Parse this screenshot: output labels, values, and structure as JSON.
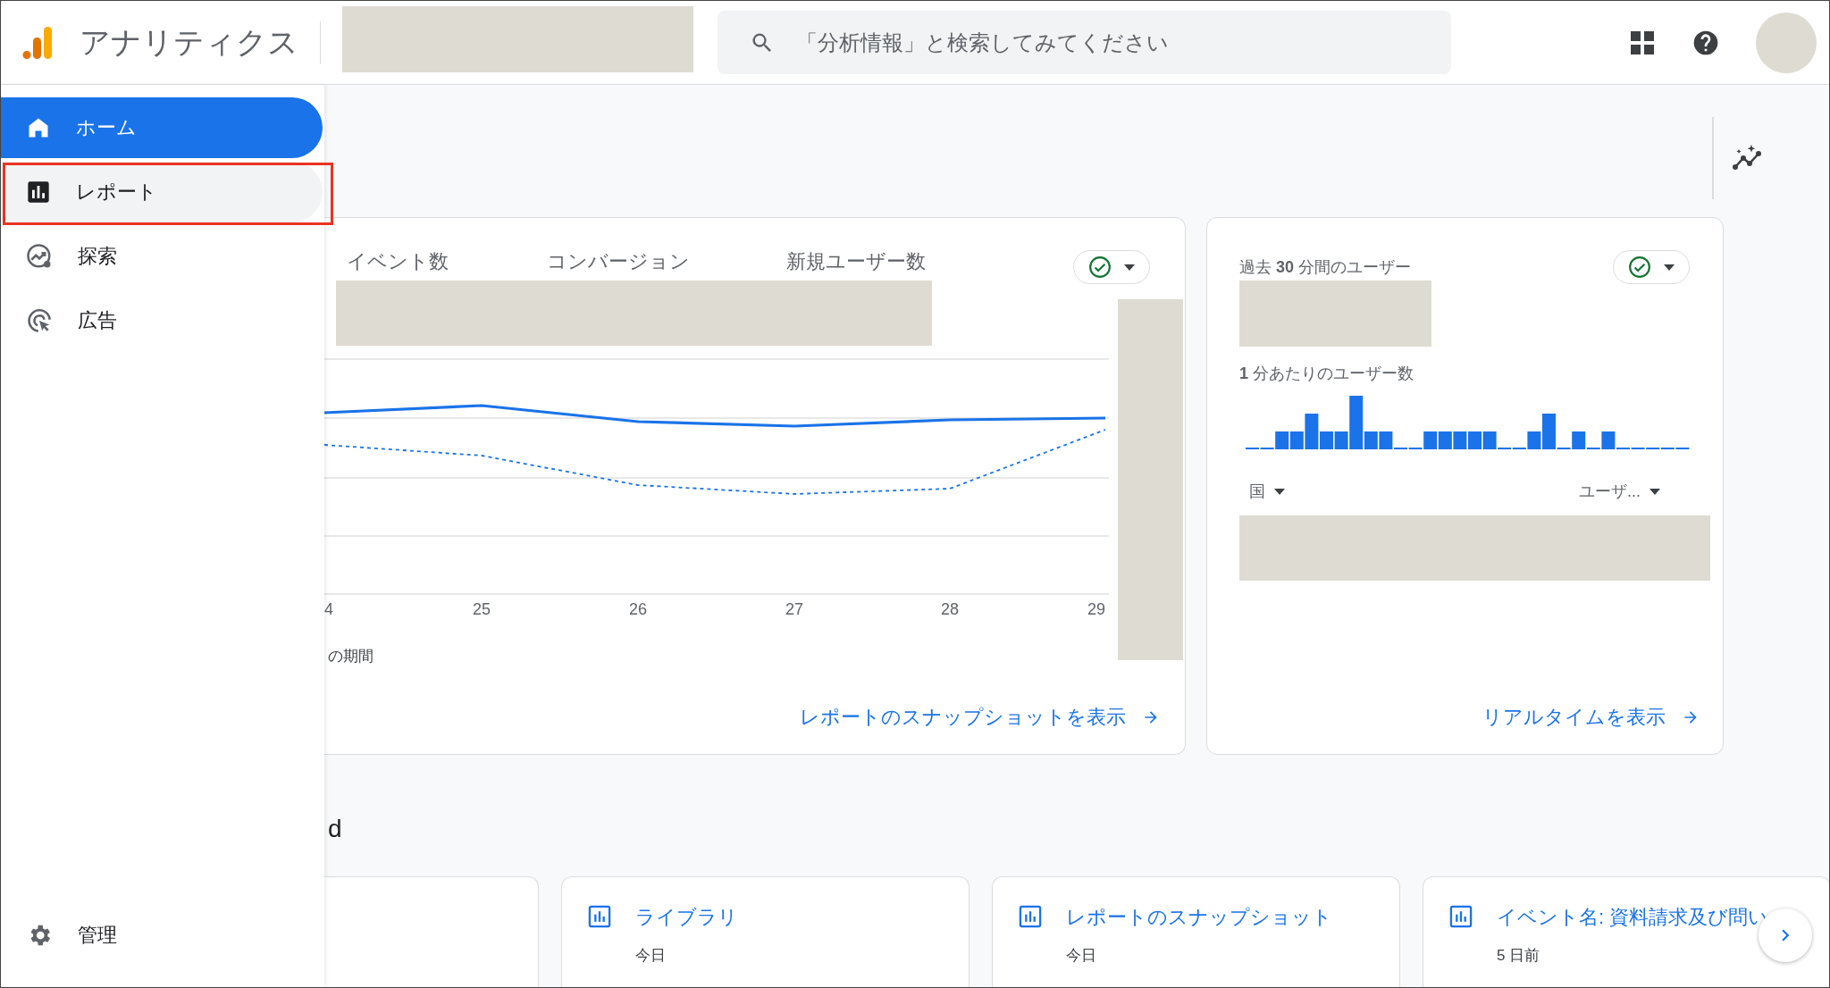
{
  "header": {
    "app_title": "アナリティクス",
    "search": {
      "placeholder": "「分析情報」と検索してみてください"
    }
  },
  "sidebar": {
    "items": [
      {
        "label": "ホーム",
        "selected": true,
        "highlighted": false
      },
      {
        "label": "レポート",
        "selected": false,
        "highlighted": true
      },
      {
        "label": "探索",
        "selected": false,
        "highlighted": false
      },
      {
        "label": "広告",
        "selected": false,
        "highlighted": false
      }
    ],
    "footer_item": {
      "label": "管理"
    }
  },
  "overview_card": {
    "tabs": [
      {
        "label": "イベント数"
      },
      {
        "label": "コンバージョン"
      },
      {
        "label": "新規ユーザー数"
      }
    ],
    "x_labels": [
      "4",
      "25",
      "26",
      "27",
      "28",
      "29"
    ],
    "legend": "の期間",
    "link": "レポートのスナップショットを表示"
  },
  "realtime_card": {
    "title": "過去 **30** 分間のユーザー",
    "subtitle": "**1** 分あたりのユーザー数",
    "dimension": "国",
    "metric": "ユーザ...",
    "link": "リアルタイムを表示"
  },
  "recent": {
    "heading": "d",
    "cards": [
      {
        "title": "ライブラリ",
        "time": "今日"
      },
      {
        "title": "レポートのスナップショット",
        "time": "今日"
      },
      {
        "title": "イベント名: 資料請求及び問い",
        "time": "5 日前"
      }
    ]
  }
}
